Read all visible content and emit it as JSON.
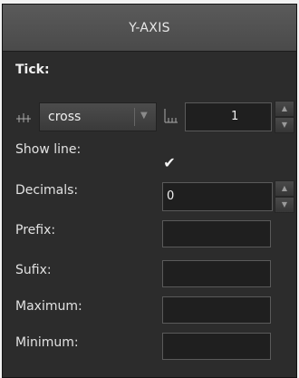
{
  "header": {
    "title": "Y-AXIS"
  },
  "tick": {
    "section_label": "Tick:",
    "style_dropdown": {
      "value": "cross"
    },
    "interval_value": "1"
  },
  "show_line": {
    "label": "Show line:",
    "checked": true
  },
  "decimals": {
    "label": "Decimals:",
    "value": "0"
  },
  "prefix": {
    "label": "Prefix:",
    "value": ""
  },
  "sufix": {
    "label": "Sufix:",
    "value": ""
  },
  "maximum": {
    "label": "Maximum:",
    "value": ""
  },
  "minimum": {
    "label": "Minimum:",
    "value": ""
  },
  "icons": {
    "tick_style": "tick-cross-icon",
    "tick_interval": "tick-interval-icon",
    "check": "checkmark-icon"
  }
}
